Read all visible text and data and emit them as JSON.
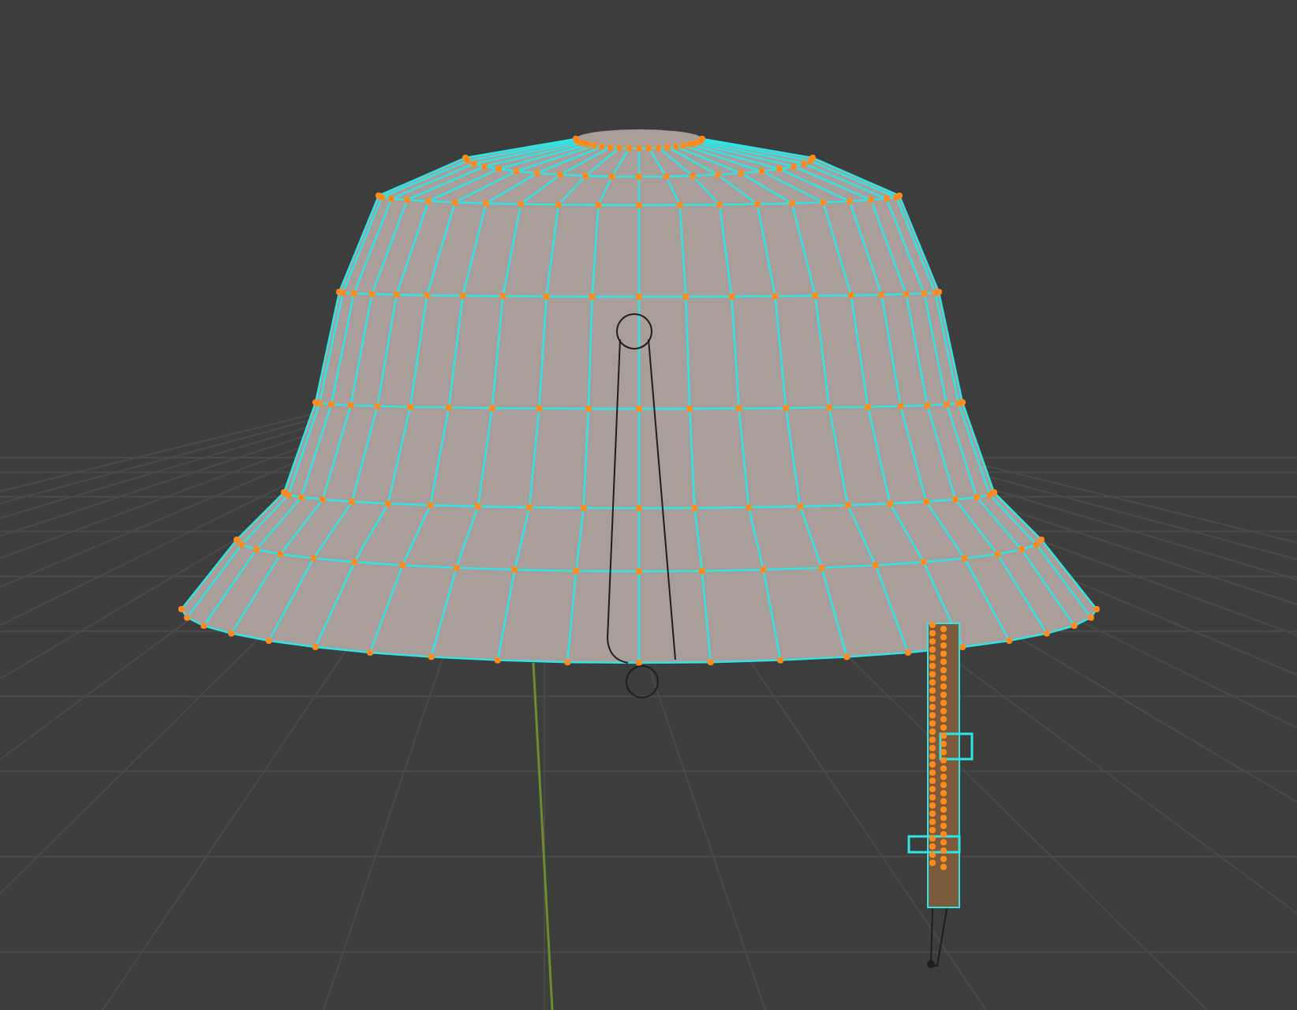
{
  "viewport": {
    "show_grid": true,
    "show_wireframe": true,
    "show_armature": true
  }
}
